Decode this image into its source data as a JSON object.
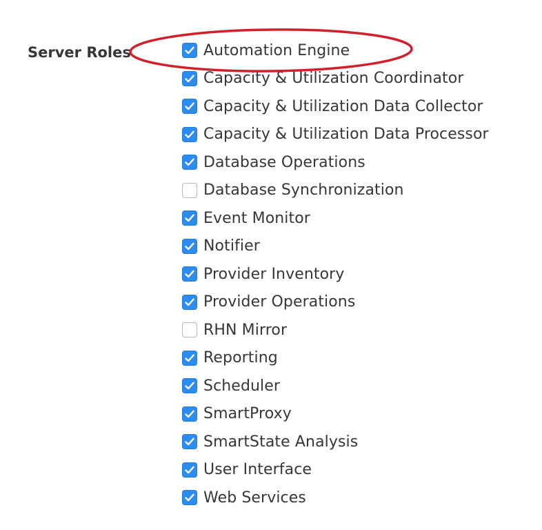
{
  "field_label": "Server Roles",
  "colors": {
    "checkbox_checked": "#2d8cf0",
    "annotation": "#d0212a"
  },
  "icons": {
    "checked": "checkmark-icon",
    "annotation": "highlight-ellipse"
  },
  "roles": [
    {
      "label": "Automation Engine",
      "checked": true
    },
    {
      "label": "Capacity & Utilization Coordinator",
      "checked": true
    },
    {
      "label": "Capacity & Utilization Data Collector",
      "checked": true
    },
    {
      "label": "Capacity & Utilization Data Processor",
      "checked": true
    },
    {
      "label": "Database Operations",
      "checked": true
    },
    {
      "label": "Database Synchronization",
      "checked": false
    },
    {
      "label": "Event Monitor",
      "checked": true
    },
    {
      "label": "Notifier",
      "checked": true
    },
    {
      "label": "Provider Inventory",
      "checked": true
    },
    {
      "label": "Provider Operations",
      "checked": true
    },
    {
      "label": "RHN Mirror",
      "checked": false
    },
    {
      "label": "Reporting",
      "checked": true
    },
    {
      "label": "Scheduler",
      "checked": true
    },
    {
      "label": "SmartProxy",
      "checked": true
    },
    {
      "label": "SmartState Analysis",
      "checked": true
    },
    {
      "label": "User Interface",
      "checked": true
    },
    {
      "label": "Web Services",
      "checked": true
    }
  ]
}
